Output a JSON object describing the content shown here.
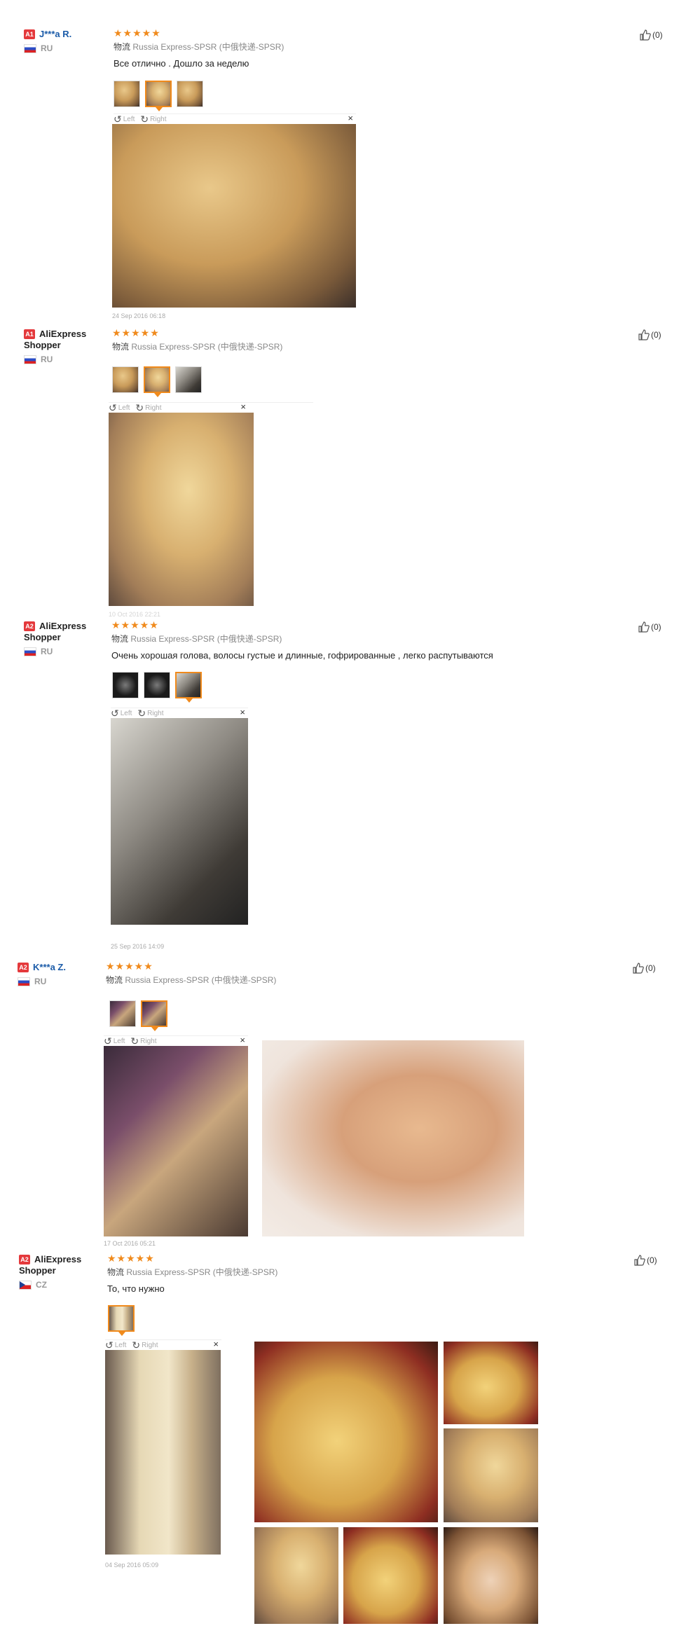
{
  "reviews": [
    {
      "badge": "A1",
      "name": "J***a R.",
      "country": "RU",
      "rating": "★★★★★",
      "logistics_label": "物流",
      "logistics": "Russia Express-SPSR (中俄快递-SPSR)",
      "comment": "Все отлично . Дошло за неделю",
      "date": "24 Sep 2016 06:18",
      "helpful": "(0)",
      "viewer_left": "Left",
      "viewer_right": "Right",
      "close": "×"
    },
    {
      "badge": "A1",
      "name": "AliExpress Shopper",
      "country": "RU",
      "rating": "★★★★★",
      "logistics_label": "物流",
      "logistics": "Russia Express-SPSR (中俄快递-SPSR)",
      "comment": "",
      "date": "10 Oct 2016 22:21",
      "helpful": "(0)",
      "viewer_left": "Left",
      "viewer_right": "Right",
      "close": "×"
    },
    {
      "badge": "A2",
      "name": "AliExpress Shopper",
      "country": "RU",
      "rating": "★★★★★",
      "logistics_label": "物流",
      "logistics": "Russia Express-SPSR (中俄快递-SPSR)",
      "comment": "Очень хорошая голова, волосы густые и длинные, гофрированные , легко распутываются",
      "date": "25 Sep 2016 14:09",
      "helpful": "(0)",
      "viewer_left": "Left",
      "viewer_right": "Right",
      "close": "×"
    },
    {
      "badge": "A2",
      "name": "K***a Z.",
      "country": "RU",
      "rating": "★★★★★",
      "logistics_label": "物流",
      "logistics": "Russia Express-SPSR (中俄快递-SPSR)",
      "comment": "",
      "date": "17 Oct 2016 05:21",
      "helpful": "(0)",
      "viewer_left": "Left",
      "viewer_right": "Right",
      "close": "×"
    },
    {
      "badge": "A2",
      "name": "AliExpress Shopper",
      "country": "CZ",
      "rating": "★★★★★",
      "logistics_label": "物流",
      "logistics": "Russia Express-SPSR (中俄快递-SPSR)",
      "comment": "То, что нужно",
      "date": "04 Sep 2016 05:09",
      "helpful": "(0)",
      "viewer_left": "Left",
      "viewer_right": "Right",
      "close": "×"
    }
  ],
  "colors": {
    "accent": "#f08a1c",
    "badge": "#e4393c",
    "link": "#1b5ba8"
  },
  "icons": {
    "like": "thumbs-up-icon",
    "rotate_left": "rotate-left-icon",
    "rotate_right": "rotate-right-icon",
    "close": "close-icon",
    "flag_ru": "flag-ru-icon",
    "flag_cz": "flag-cz-icon"
  }
}
